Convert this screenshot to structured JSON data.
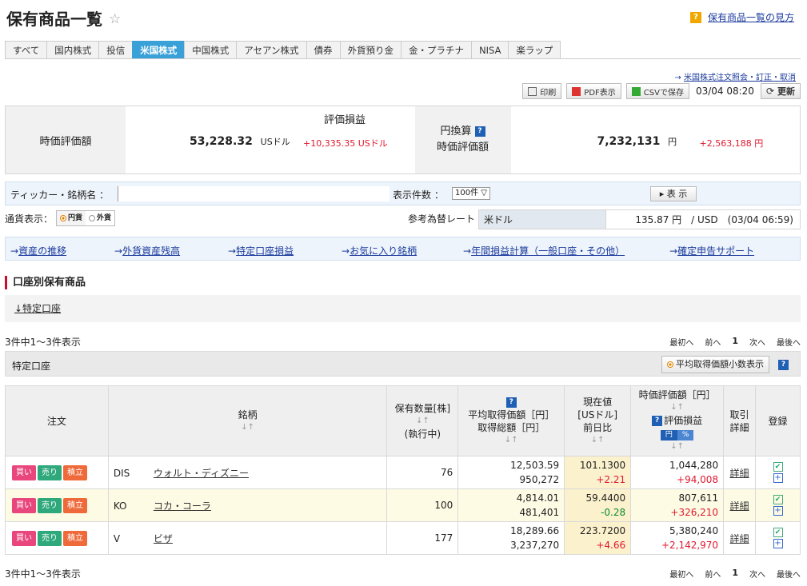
{
  "page": {
    "title": "保有商品一覧",
    "help_label": "保有商品一覧の見方",
    "help_mark": "?"
  },
  "tabs": [
    {
      "label": "すべて"
    },
    {
      "label": "国内株式"
    },
    {
      "label": "投信"
    },
    {
      "label": "米国株式",
      "active": true
    },
    {
      "label": "中国株式"
    },
    {
      "label": "アセアン株式"
    },
    {
      "label": "債券"
    },
    {
      "label": "外貨預り金"
    },
    {
      "label": "金・プラチナ"
    },
    {
      "label": "NISA"
    },
    {
      "label": "楽ラップ"
    }
  ],
  "toolbar": {
    "order_link": "米国株式注文照会・訂正・取消",
    "print": "印刷",
    "pdf": "PDF表示",
    "csv": "CSVで保存",
    "timestamp": "03/04 08:20",
    "refresh": "更新"
  },
  "summary": {
    "market_value_label": "時価評価額",
    "unrealized_label": "評価損益",
    "market_value_usd": "53,228.32",
    "usd_unit": "USドル",
    "unrealized_usd": "+10,335.35 USドル",
    "yen_label_1": "円換算",
    "yen_label_2": "時価評価額",
    "market_value_jpy": "7,232,131",
    "jpy_unit": "円",
    "unrealized_jpy": "+2,563,188 円",
    "help_mark": "?"
  },
  "search": {
    "ticker_label": "ティッカー・銘柄名 ：",
    "ticker_value": "",
    "count_label": "表示件数 ：",
    "count_value": "100件 ▽",
    "show_button": "▸ 表 示"
  },
  "currency": {
    "label": "通貨表示：",
    "yen": "円貨",
    "fx": "外貨"
  },
  "rate": {
    "label": "参考為替レート",
    "currency": "米ドル",
    "value": "135.87 円　/ USD　(03/04 06:59)"
  },
  "links": [
    "資産の推移",
    "外貨資産残高",
    "特定口座損益",
    "お気に入り銘柄",
    "年間損益計算（一般口座・その他）",
    "確定申告サポート"
  ],
  "section": {
    "title": "口座別保有商品",
    "account_link": "↓特定口座"
  },
  "pagination": {
    "count_text": "3件中1～3件表示",
    "first": "最初へ",
    "prev": "前へ",
    "page": "1",
    "next": "次へ",
    "last": "最後へ"
  },
  "account": {
    "name": "特定口座",
    "avg_button": "平均取得価額小数表示",
    "help_mark": "?"
  },
  "table": {
    "headers": {
      "order": "注文",
      "name": "銘柄",
      "qty_1": "保有数量[株]",
      "qty_2": "(執行中)",
      "avg_1": "平均取得価額［円］",
      "avg_2": "取得総額［円］",
      "price_1": "現在値",
      "price_2": "[USドル]",
      "price_3": "前日比",
      "val_1": "時価評価額［円］",
      "val_2": "評価損益",
      "val_yen": "円",
      "val_pct": "%",
      "detail_1": "取引",
      "detail_2": "詳細",
      "reg": "登録",
      "sort": "↓↑"
    },
    "buttons": {
      "buy": "買い",
      "sell": "売り",
      "tsumi": "積立",
      "detail": "詳細"
    },
    "rows": [
      {
        "ticker": "DIS",
        "name": "ウォルト・ディズニー",
        "qty": "76",
        "avg": "12,503.59",
        "total": "950,272",
        "price": "101.1300",
        "change": "+2.21",
        "change_dir": "up",
        "value": "1,044,280",
        "pl": "+94,008"
      },
      {
        "ticker": "KO",
        "name": "コカ・コーラ",
        "qty": "100",
        "avg": "4,814.01",
        "total": "481,401",
        "price": "59.4400",
        "change": "-0.28",
        "change_dir": "down",
        "value": "807,611",
        "pl": "+326,210"
      },
      {
        "ticker": "V",
        "name": "ビザ",
        "qty": "177",
        "avg": "18,289.66",
        "total": "3,237,270",
        "price": "223.7200",
        "change": "+4.66",
        "change_dir": "up",
        "value": "5,380,240",
        "pl": "+2,142,970"
      }
    ]
  },
  "colors": {
    "active_tab": "#3aa0d8",
    "gain": "#e0182e",
    "loss": "#0a8a2a",
    "buy": "#e8467c",
    "sell": "#2fa87c",
    "tsumi": "#ef6a3a"
  }
}
